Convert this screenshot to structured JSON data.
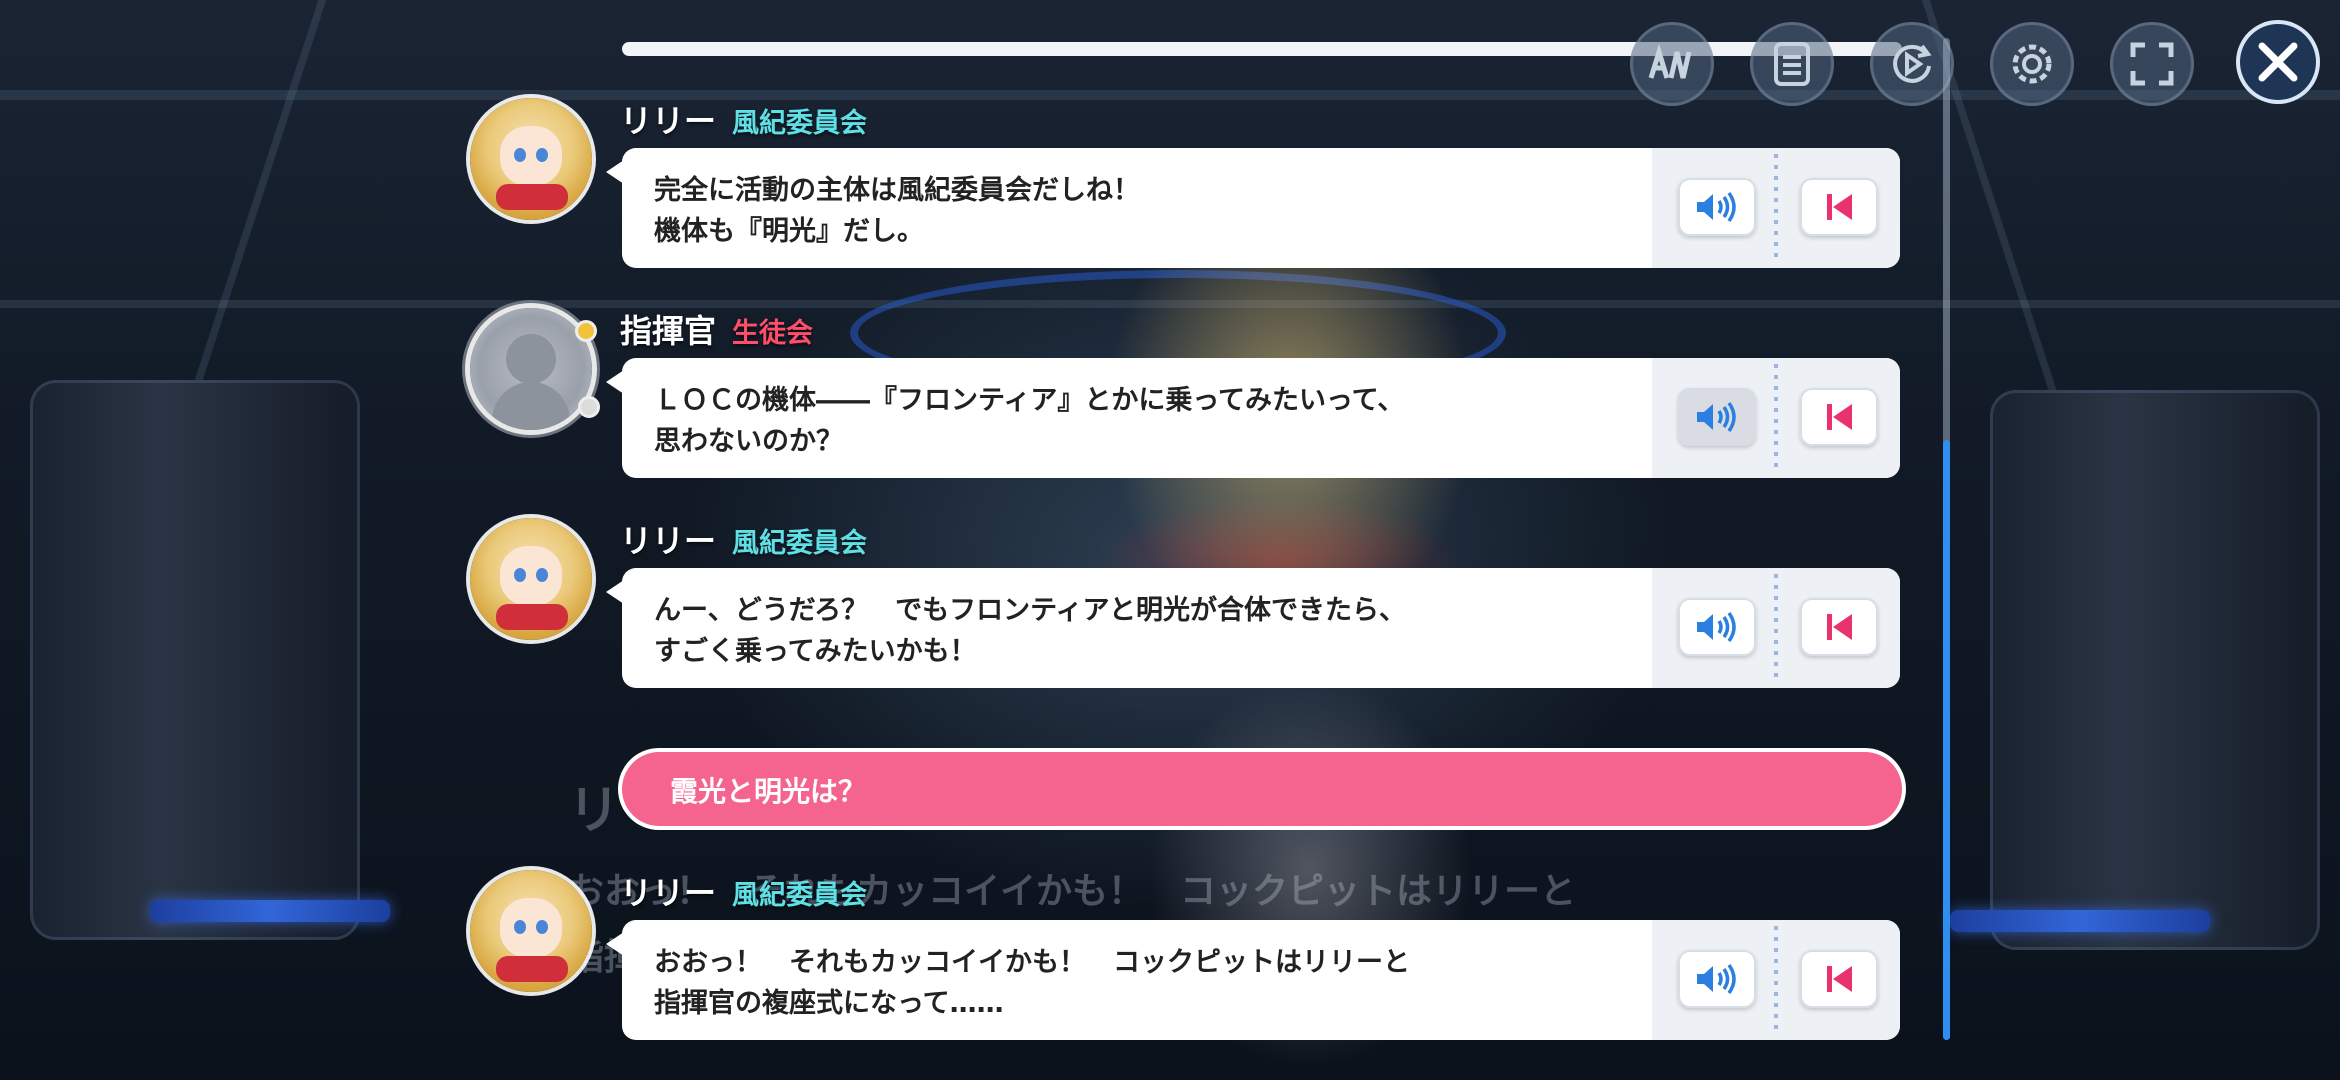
{
  "toolbar": {
    "icons": [
      "auto-icon",
      "log-icon",
      "replay-icon",
      "settings-icon",
      "fullscreen-icon",
      "close-icon"
    ]
  },
  "background_text": {
    "name_fragment": "リ",
    "line_1": "おおっ！　それもカッコイイかも！　コックピットはリリーと",
    "line_2": "指揮"
  },
  "entries": [
    {
      "speaker": "リリー",
      "affiliation": "風紀委員会",
      "affiliation_color": "#5fe0e6",
      "avatar": "lily-avatar",
      "text": "完全に活動の主体は風紀委員会だしね！\n機体も『明光』だし。",
      "voice_playing": false
    },
    {
      "speaker": "指揮官",
      "affiliation": "生徒会",
      "affiliation_color": "#ff4d6b",
      "avatar": "commander-avatar",
      "text": "ＬＯＣの機体――『フロンティア』とかに乗ってみたいって、\n思わないのか？",
      "voice_playing": true
    },
    {
      "speaker": "リリー",
      "affiliation": "風紀委員会",
      "affiliation_color": "#5fe0e6",
      "avatar": "lily-avatar",
      "text": "んー、どうだろ？　でもフロンティアと明光が合体できたら、\nすごく乗ってみたいかも！",
      "voice_playing": false
    },
    {
      "speaker": "リリー",
      "affiliation": "風紀委員会",
      "affiliation_color": "#5fe0e6",
      "avatar": "lily-avatar",
      "text": "おおっ！　それもカッコイイかも！　コックピットはリリーと\n指揮官の複座式になって……",
      "voice_playing": false
    }
  ],
  "choice": {
    "label": "霞光と明光は？",
    "color": "#f5648f"
  },
  "accent_blue": "#2f8ff0",
  "jump_icon_color": "#e8336d"
}
